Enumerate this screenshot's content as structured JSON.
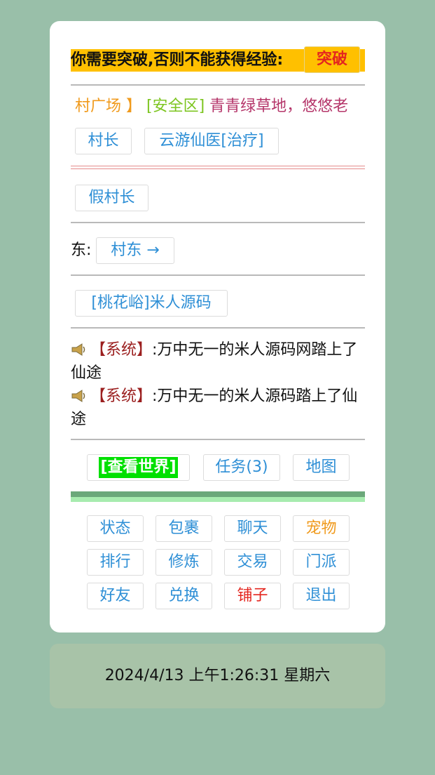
{
  "breakthrough": {
    "prompt": "你需要突破,否则不能获得经验:",
    "button": "突破"
  },
  "location": {
    "name": "村广场 】",
    "safe_zone": "[安全区]",
    "description": "青青绿草地，悠悠老"
  },
  "npcs": [
    "村长",
    "云游仙医[治疗]"
  ],
  "players_nearby": [
    "假村长"
  ],
  "exits": {
    "direction_label": "东:",
    "east": "村东 →"
  },
  "current_player": "[桃花峪]米人源码",
  "messages": [
    {
      "tag": "【系统】",
      "text": ":万中无一的米人源码网踏上了仙途"
    },
    {
      "tag": "【系统】",
      "text": ":万中无一的米人源码踏上了仙途"
    }
  ],
  "actions": {
    "world": "[查看世界]",
    "tasks": "任务(3)",
    "map": "地图"
  },
  "menu": [
    {
      "label": "状态",
      "color": "#2e8fd6"
    },
    {
      "label": "包裹",
      "color": "#2e8fd6"
    },
    {
      "label": "聊天",
      "color": "#2e8fd6"
    },
    {
      "label": "宠物",
      "color": "#f09a1c"
    },
    {
      "label": "排行",
      "color": "#2e8fd6"
    },
    {
      "label": "修炼",
      "color": "#2e8fd6"
    },
    {
      "label": "交易",
      "color": "#2e8fd6"
    },
    {
      "label": "门派",
      "color": "#2e8fd6"
    },
    {
      "label": "好友",
      "color": "#2e8fd6"
    },
    {
      "label": "兑换",
      "color": "#2e8fd6"
    },
    {
      "label": "铺子",
      "color": "#e4261f"
    },
    {
      "label": "退出",
      "color": "#2e8fd6"
    }
  ],
  "footer": {
    "datetime": "2024/4/13 上午1:26:31 星期六"
  }
}
